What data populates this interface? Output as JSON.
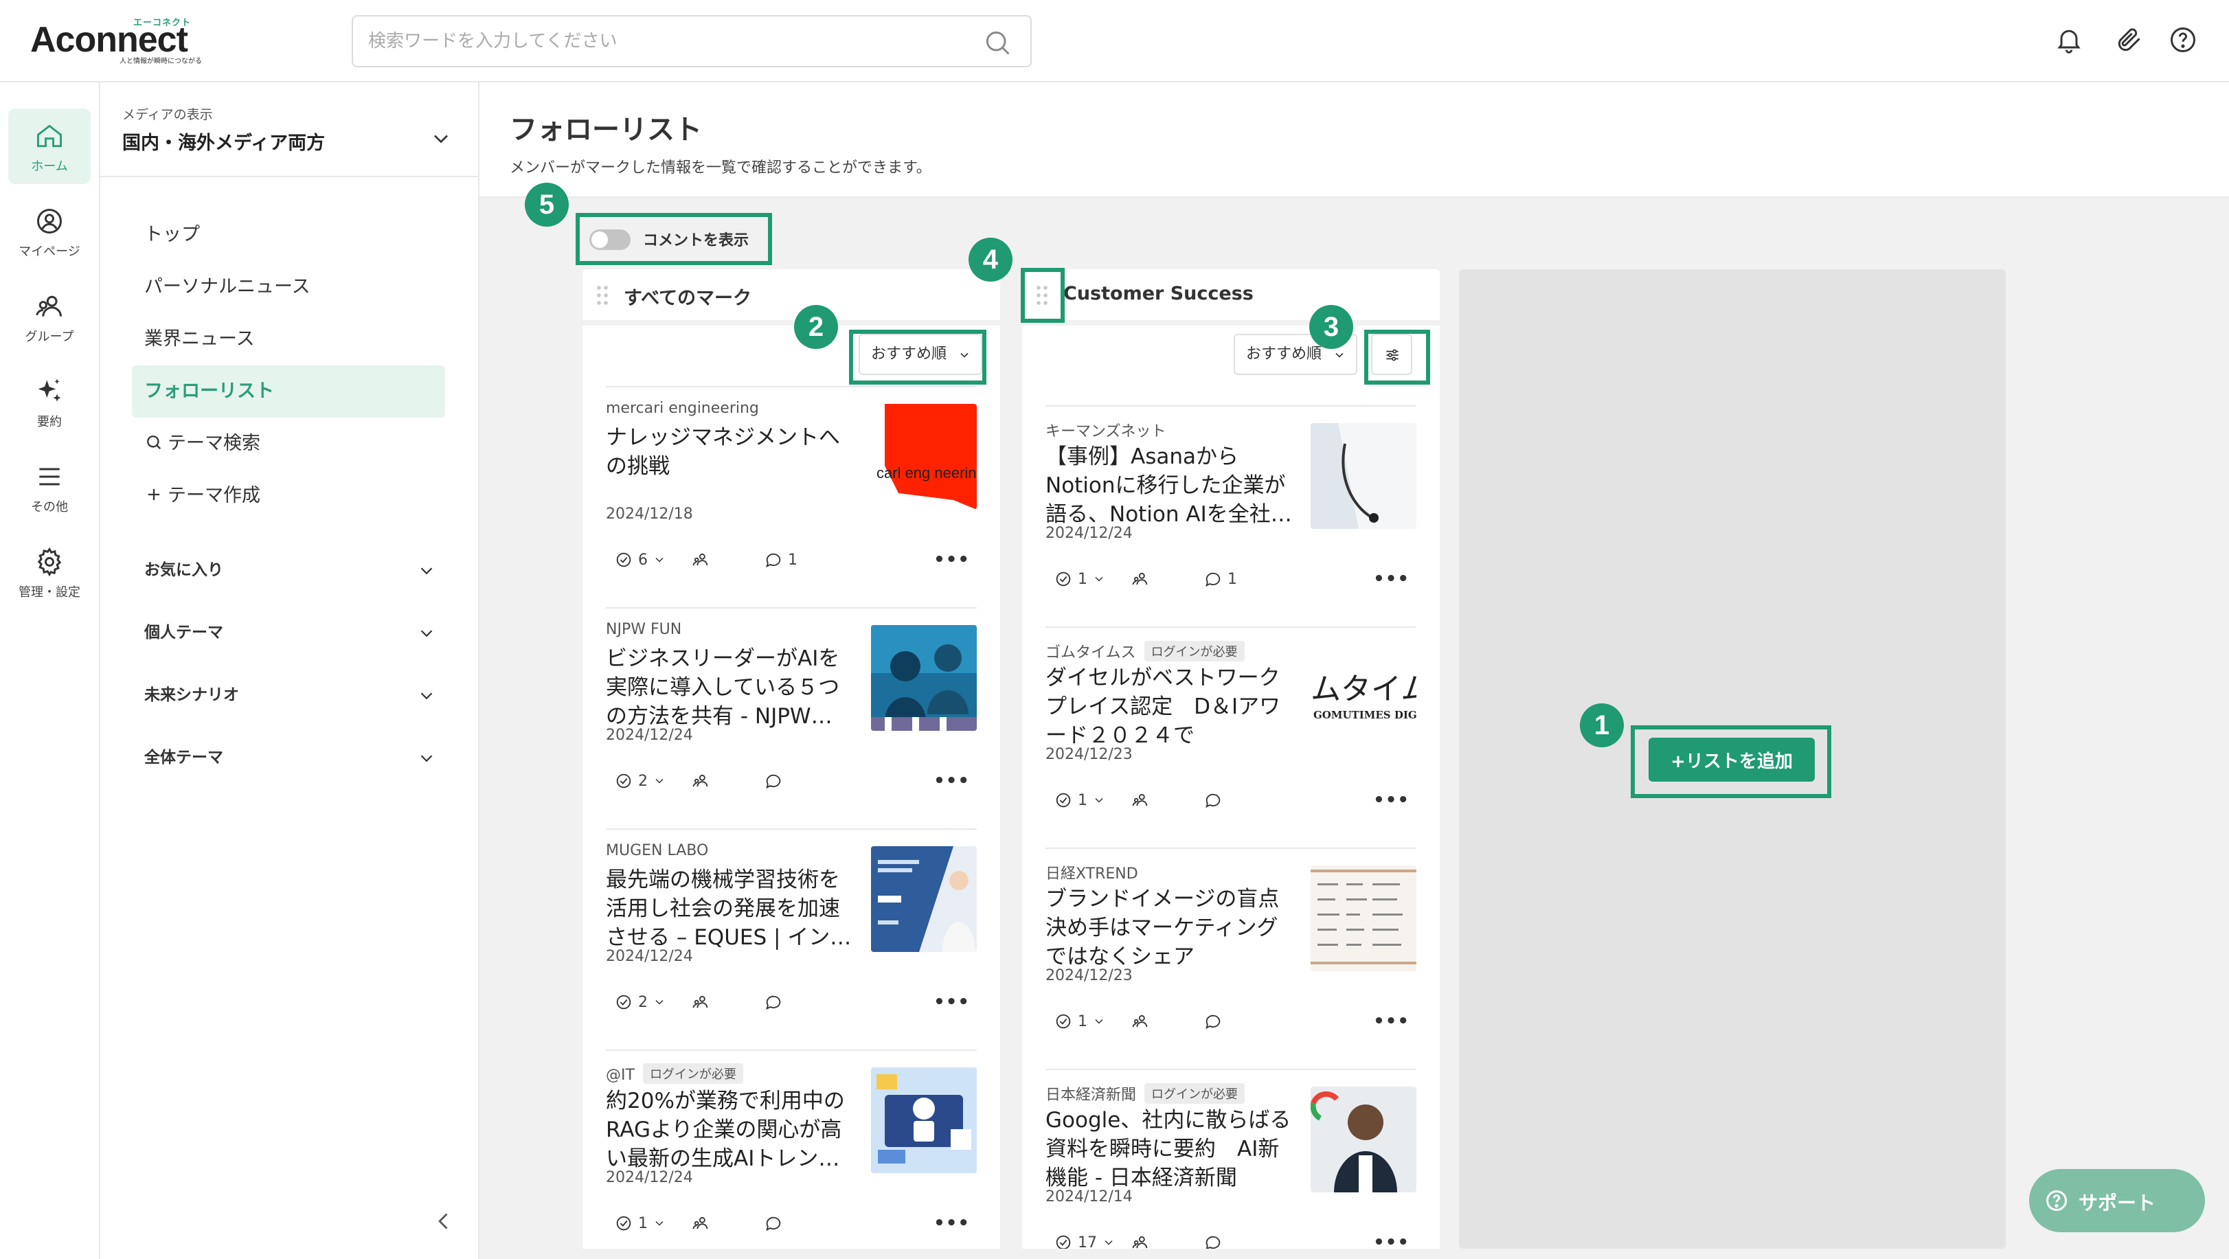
{
  "header": {
    "logo_text": "Aconnect",
    "logo_small": "エーコネクト",
    "logo_tagline": "人と情報が瞬時につながる",
    "search_placeholder": "検索ワードを入力してください"
  },
  "rail": {
    "items": [
      {
        "label": "ホーム",
        "icon": "home-icon",
        "active": true
      },
      {
        "label": "マイページ",
        "icon": "user-circle-icon"
      },
      {
        "label": "グループ",
        "icon": "group-icon"
      },
      {
        "label": "要約",
        "icon": "sparkle-icon"
      },
      {
        "label": "その他",
        "icon": "menu-icon"
      },
      {
        "label": "管理・設定",
        "icon": "gear-icon"
      }
    ]
  },
  "nav": {
    "media_label": "メディアの表示",
    "media_value": "国内・海外メディア両方",
    "items": [
      "トップ",
      "パーソナルニュース",
      "業界ニュース",
      "フォローリスト",
      "テーマ検索",
      "テーマ作成"
    ],
    "groups": [
      "お気に入り",
      "個人テーマ",
      "未来シナリオ",
      "全体テーマ"
    ]
  },
  "page": {
    "title": "フォローリスト",
    "description": "メンバーがマークした情報を一覧で確認することができます。",
    "toggle_label": "コメントを表示"
  },
  "badges": [
    "1",
    "2",
    "3",
    "4",
    "5"
  ],
  "columns": [
    {
      "title": "すべてのマーク",
      "sort_label": "おすすめ順",
      "cards": [
        {
          "source": "mercari engineering",
          "tag": "",
          "title": "ナレッジマネジメントへの挑戦",
          "date": "2024/12/18",
          "checks": "6",
          "comments": "1"
        },
        {
          "source": "NJPW FUN",
          "tag": "",
          "title": "ビジネスリーダーがAIを実際に導入している５つの方法を共有 - NJPW…",
          "date": "2024/12/24",
          "checks": "2",
          "comments": ""
        },
        {
          "source": "MUGEN LABO",
          "tag": "",
          "title": "最先端の機械学習技術を活用し社会の発展を加速させる – EQUES | イン…",
          "date": "2024/12/24",
          "checks": "2",
          "comments": ""
        },
        {
          "source": "@IT",
          "tag": "ログインが必要",
          "title": "約20%が業務で利用中のRAGより企業の関心が高い最新の生成AIトレン…",
          "date": "2024/12/24",
          "checks": "1",
          "comments": ""
        }
      ]
    },
    {
      "title": "Customer Success",
      "sort_label": "おすすめ順",
      "cards": [
        {
          "source": "キーマンズネット",
          "tag": "",
          "title": "【事例】Asanaから Notionに移行した企業が語る、Notion AIを全社…",
          "date": "2024/12/24",
          "checks": "1",
          "comments": "1"
        },
        {
          "source": "ゴムタイムス",
          "tag": "ログインが必要",
          "title": "ダイセルがベストワークプレイス認定　D＆Iアワード２０２４で",
          "date": "2024/12/23",
          "checks": "1",
          "comments": ""
        },
        {
          "source": "日経XTREND",
          "tag": "",
          "title": "ブランドイメージの盲点　決め手はマーケティングではなくシェア",
          "date": "2024/12/23",
          "checks": "1",
          "comments": ""
        },
        {
          "source": "日本経済新聞",
          "tag": "ログインが必要",
          "title": "Google、社内に散らばる資料を瞬時に要約　AI新機能 - 日本経済新聞",
          "date": "2024/12/14",
          "checks": "17",
          "comments": ""
        }
      ]
    }
  ],
  "thumb_texts": {
    "mercari": "carl eng neering",
    "gomu_main": "ムタイム",
    "gomu_sub": "GOMUTIMES DIGI"
  },
  "add_list_label": "+リストを追加",
  "support_label": "サポート",
  "colors": {
    "accent": "#1f9a73",
    "active_bg": "#e6f4ee",
    "support": "#7fbfa6"
  }
}
